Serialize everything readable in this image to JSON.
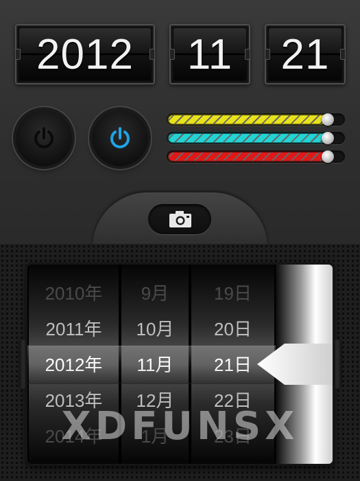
{
  "flip_date": {
    "year": "2012",
    "month": "11",
    "day": "21"
  },
  "power_buttons": [
    {
      "name": "power-off",
      "color": "#2a2a2a"
    },
    {
      "name": "power-on",
      "color": "#1fa3e6"
    }
  ],
  "sliders": [
    {
      "color": "#e8e21a",
      "level": 0.92
    },
    {
      "color": "#22d4d4",
      "level": 0.92
    },
    {
      "color": "#e01818",
      "level": 0.92
    }
  ],
  "camera_button": {
    "icon": "camera-icon"
  },
  "picker": {
    "years": [
      "2010年",
      "2011年",
      "2012年",
      "2013年",
      "2014年"
    ],
    "months": [
      "9月",
      "10月",
      "11月",
      "12月",
      "1月"
    ],
    "days": [
      "19日",
      "20日",
      "21日",
      "22日",
      "23日"
    ],
    "selected_index": 2
  },
  "watermark": "XDFUNSX"
}
